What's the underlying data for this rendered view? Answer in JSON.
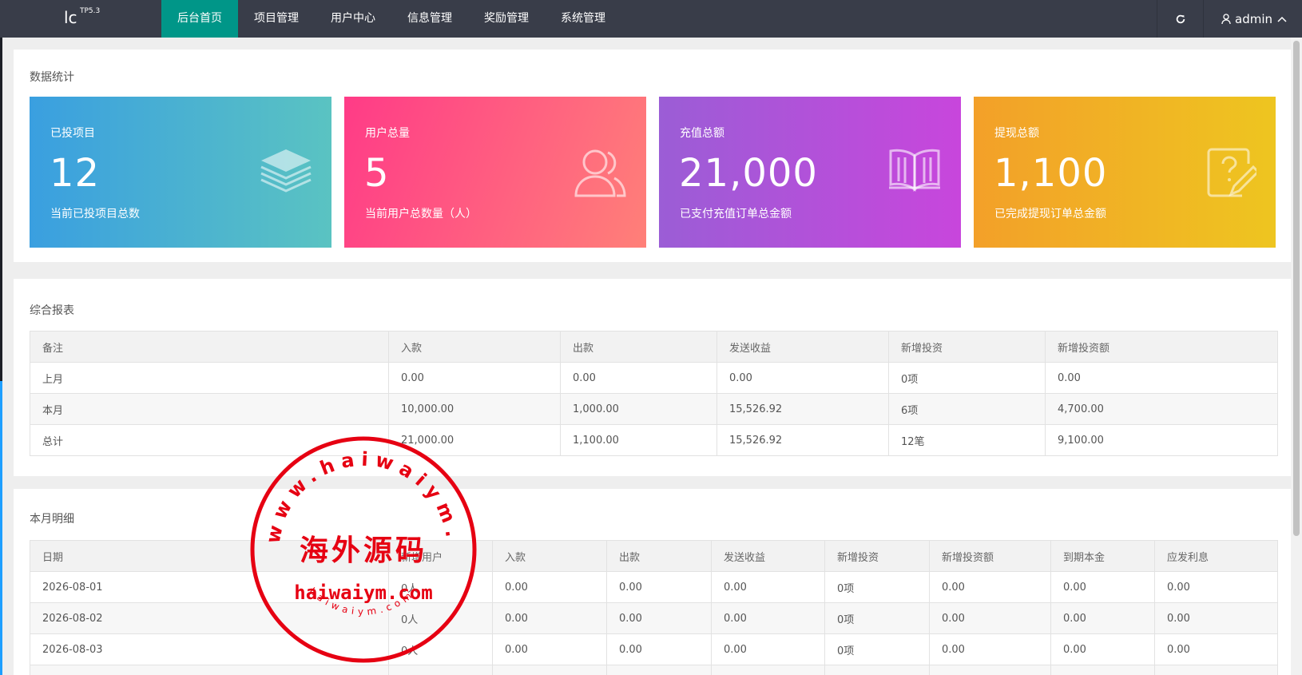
{
  "brand": {
    "logo": "lc",
    "version": "TP5.3"
  },
  "nav": [
    {
      "label": "后台首页",
      "active": true
    },
    {
      "label": "项目管理",
      "active": false
    },
    {
      "label": "用户中心",
      "active": false
    },
    {
      "label": "信息管理",
      "active": false
    },
    {
      "label": "奖励管理",
      "active": false
    },
    {
      "label": "系统管理",
      "active": false
    }
  ],
  "header_right": {
    "refresh_icon": "refresh-icon",
    "user": "admin",
    "user_icon": "user-icon",
    "chevron_icon": "chevron-up-icon"
  },
  "stats": {
    "title": "数据统计",
    "cards": [
      {
        "title": "已投项目",
        "value": "12",
        "desc": "当前已投项目总数",
        "icon": "layers-icon",
        "gradient": [
          "#3a9fe0",
          "#5ac3c2"
        ]
      },
      {
        "title": "用户总量",
        "value": "5",
        "desc": "当前用户总数量（人）",
        "icon": "users-icon",
        "gradient": [
          "#ff3b87",
          "#ff8078"
        ]
      },
      {
        "title": "充值总额",
        "value": "21,000",
        "desc": "已支付充值订单总金额",
        "icon": "book-icon",
        "gradient": [
          "#9b5dd6",
          "#c846dc"
        ]
      },
      {
        "title": "提现总额",
        "value": "1,100",
        "desc": "已完成提现订单总金额",
        "icon": "question-edit-icon",
        "gradient": [
          "#f3a029",
          "#eec520"
        ]
      }
    ]
  },
  "report": {
    "title": "综合报表",
    "columns": [
      "备注",
      "入款",
      "出款",
      "发送收益",
      "新增投资",
      "新增投资额"
    ],
    "rows": [
      [
        "上月",
        "0.00",
        "0.00",
        "0.00",
        "0项",
        "0.00"
      ],
      [
        "本月",
        "10,000.00",
        "1,000.00",
        "15,526.92",
        "6项",
        "4,700.00"
      ],
      [
        "总计",
        "21,000.00",
        "1,100.00",
        "15,526.92",
        "12笔",
        "9,100.00"
      ]
    ]
  },
  "monthly": {
    "title": "本月明细",
    "columns": [
      "日期",
      "新增用户",
      "入款",
      "出款",
      "发送收益",
      "新增投资",
      "新增投资额",
      "到期本金",
      "应发利息"
    ],
    "rows": [
      [
        "2026-08-01",
        "0人",
        "0.00",
        "0.00",
        "0.00",
        "0项",
        "0.00",
        "0.00",
        "0.00"
      ],
      [
        "2026-08-02",
        "0人",
        "0.00",
        "0.00",
        "0.00",
        "0项",
        "0.00",
        "0.00",
        "0.00"
      ],
      [
        "2026-08-03",
        "0人",
        "0.00",
        "0.00",
        "0.00",
        "0项",
        "0.00",
        "0.00",
        "0.00"
      ],
      [
        "",
        "",
        "",
        "",
        "",
        "",
        "",
        "",
        ""
      ]
    ]
  },
  "watermark": {
    "top_arc": "www.haiwaiym.com",
    "center": "海外源码",
    "domain": "haiwaiym.com",
    "bottom_arc": "haiwaiym.com",
    "color": "#e60012"
  },
  "colors": {
    "topbar": "#393d49",
    "active": "#009688"
  }
}
